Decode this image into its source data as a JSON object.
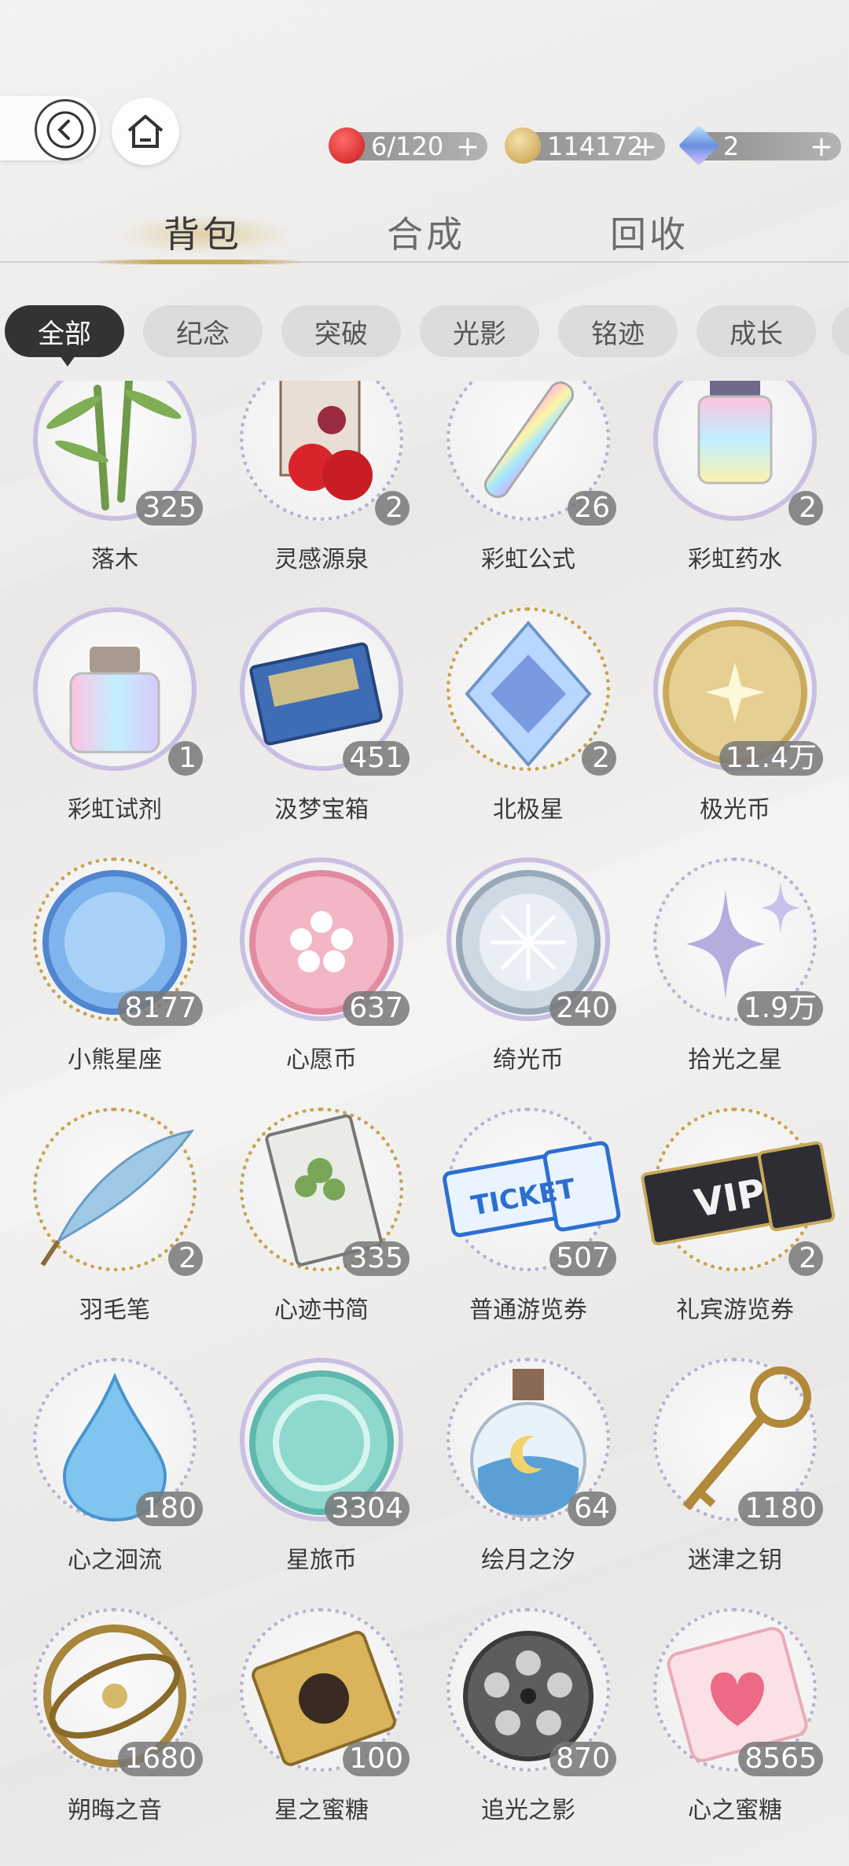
{
  "nav": {
    "back_icon": "back-arrow-icon",
    "home_icon": "home-icon"
  },
  "resources": [
    {
      "icon": "apple-icon",
      "value": "6/120",
      "plus": "+"
    },
    {
      "icon": "gold-coin-icon",
      "value": "114172",
      "plus": "+"
    },
    {
      "icon": "diamond-icon",
      "value": "2",
      "plus": "+"
    }
  ],
  "tabs": [
    {
      "label": "背包",
      "active": true
    },
    {
      "label": "合成",
      "active": false
    },
    {
      "label": "回收",
      "active": false
    }
  ],
  "filters": [
    {
      "label": "全部",
      "active": true
    },
    {
      "label": "纪念",
      "active": false
    },
    {
      "label": "突破",
      "active": false
    },
    {
      "label": "光影",
      "active": false
    },
    {
      "label": "铭迹",
      "active": false
    },
    {
      "label": "成长",
      "active": false
    }
  ],
  "items": [
    {
      "name": "落木",
      "count": "325",
      "icon": "bamboo-icon",
      "ring": "purple"
    },
    {
      "name": "灵感源泉",
      "count": "2",
      "icon": "apple-box-icon",
      "ring": "silver"
    },
    {
      "name": "彩虹公式",
      "count": "26",
      "icon": "rainbow-vial-icon",
      "ring": "silver"
    },
    {
      "name": "彩虹药水",
      "count": "2",
      "icon": "rainbow-bottle-icon",
      "ring": "purple"
    },
    {
      "name": "彩虹试剂",
      "count": "1",
      "icon": "rainbow-jar-icon",
      "ring": "purple"
    },
    {
      "name": "汲梦宝箱",
      "count": "451",
      "icon": "treasure-box-icon",
      "ring": "purple"
    },
    {
      "name": "北极星",
      "count": "2",
      "icon": "crystal-icon",
      "ring": "gold"
    },
    {
      "name": "极光币",
      "count": "11.4万",
      "icon": "gold-coin-icon",
      "ring": "purple"
    },
    {
      "name": "小熊星座",
      "count": "8177",
      "icon": "blue-coin-icon",
      "ring": "gold"
    },
    {
      "name": "心愿币",
      "count": "637",
      "icon": "pink-coin-icon",
      "ring": "purple"
    },
    {
      "name": "绮光币",
      "count": "240",
      "icon": "silver-coin-icon",
      "ring": "purple"
    },
    {
      "name": "拾光之星",
      "count": "1.9万",
      "icon": "sparkle-star-icon",
      "ring": "silver"
    },
    {
      "name": "羽毛笔",
      "count": "2",
      "icon": "quill-icon",
      "ring": "gold"
    },
    {
      "name": "心迹书简",
      "count": "335",
      "icon": "letter-icon",
      "ring": "gold"
    },
    {
      "name": "普通游览券",
      "count": "507",
      "icon": "ticket-icon",
      "ring": "silver"
    },
    {
      "name": "礼宾游览券",
      "count": "2",
      "icon": "vip-ticket-icon",
      "ring": "gold"
    },
    {
      "name": "心之洄流",
      "count": "180",
      "icon": "water-drop-icon",
      "ring": "silver"
    },
    {
      "name": "星旅币",
      "count": "3304",
      "icon": "teal-coin-icon",
      "ring": "purple"
    },
    {
      "name": "绘月之汐",
      "count": "64",
      "icon": "moon-flask-icon",
      "ring": "silver"
    },
    {
      "name": "迷津之钥",
      "count": "1180",
      "icon": "key-icon",
      "ring": "silver"
    },
    {
      "name": "朔晦之音",
      "count": "1680",
      "icon": "astrolabe-icon",
      "ring": "silver"
    },
    {
      "name": "星之蜜糖",
      "count": "100",
      "icon": "gold-candy-icon",
      "ring": "silver"
    },
    {
      "name": "追光之影",
      "count": "870",
      "icon": "film-reel-icon",
      "ring": "silver"
    },
    {
      "name": "心之蜜糖",
      "count": "8565",
      "icon": "pink-candy-icon",
      "ring": "silver"
    }
  ],
  "colors": {
    "accent_gold": "#c9a95c",
    "chip_active": "#333333",
    "ring_purple": "#c9bfe3"
  }
}
